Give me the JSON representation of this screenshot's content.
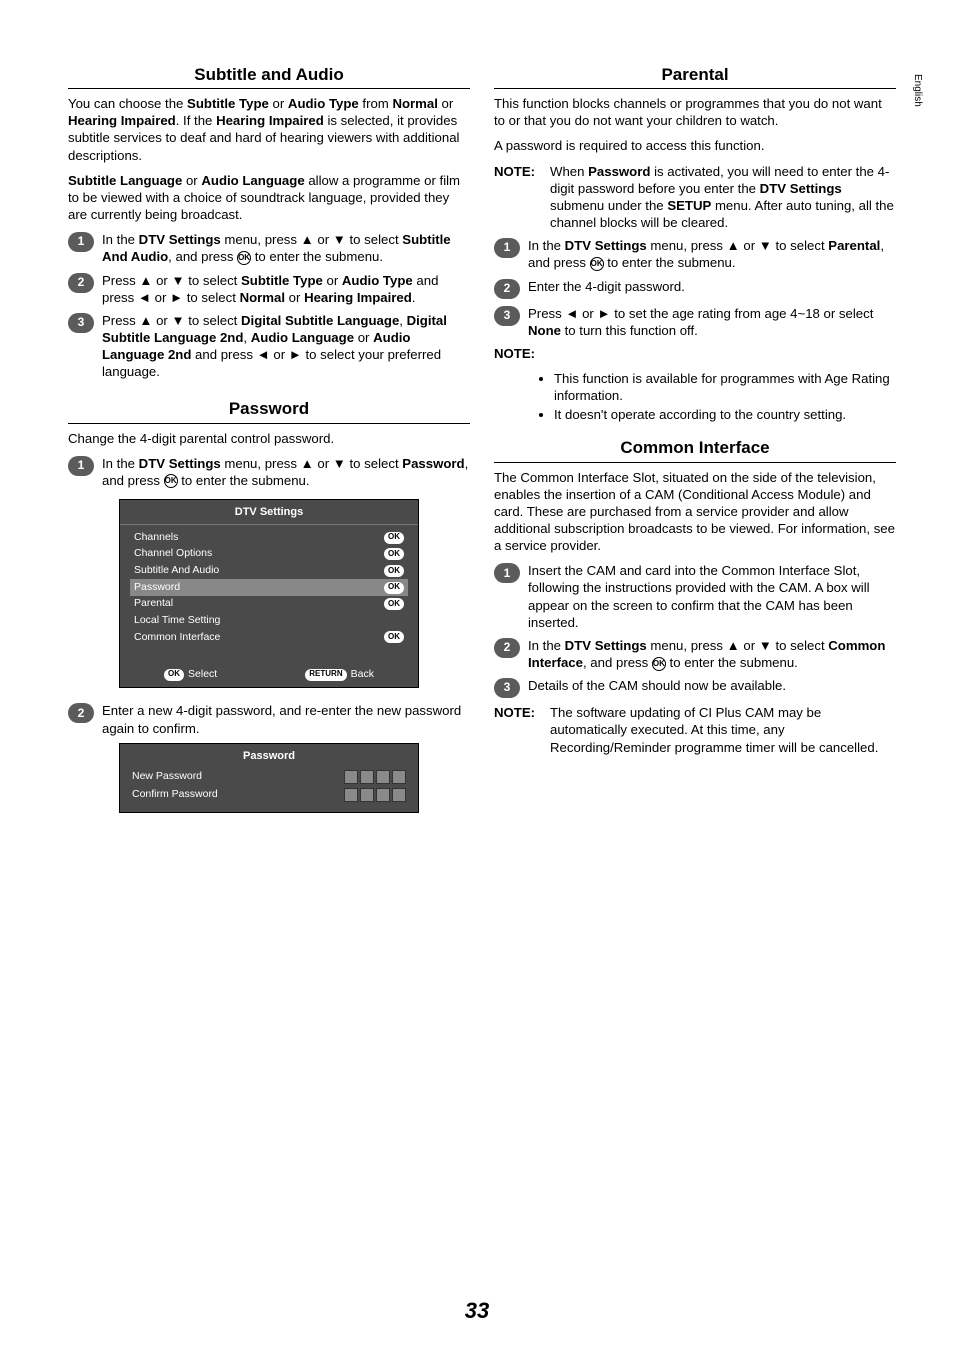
{
  "sideTab": "English",
  "pageNumber": "33",
  "glyph": {
    "up": "▲",
    "down": "▼",
    "left": "◄",
    "right": "►"
  },
  "btn": {
    "ok": "OK",
    "okCircle": "OK",
    "return": "RETURN"
  },
  "left": {
    "sec1": {
      "title": "Subtitle and Audio",
      "p1a": "You can choose the ",
      "p1b": "Subtitle Type",
      "p1c": " or ",
      "p1d": "Audio Type",
      "p1e": " from ",
      "p1f": "Normal",
      "p1g": " or ",
      "p1h": "Hearing Impaired",
      "p1i": ". If the ",
      "p1j": "Hearing Impaired",
      "p1k": " is selected, it provides subtitle services to deaf and hard of hearing viewers with additional descriptions.",
      "p2a": "Subtitle Language",
      "p2b": " or ",
      "p2c": "Audio Language",
      "p2d": " allow a programme or film to be viewed with a choice of soundtrack language, provided they are currently being broadcast.",
      "s1a": "In the ",
      "s1b": "DTV Settings",
      "s1c": " menu, press ",
      "s1d": " or ",
      "s1e": " to select ",
      "s1f": "Subtitle And Audio",
      "s1g": ", and press ",
      "s1h": " to enter the submenu.",
      "s2a": "Press ",
      "s2b": " or ",
      "s2c": " to select ",
      "s2d": "Subtitle Type",
      "s2e": " or ",
      "s2f": "Audio Type",
      "s2g": " and press ",
      "s2h": " or ",
      "s2i": " to select ",
      "s2j": "Normal",
      "s2k": " or ",
      "s2l": "Hearing Impaired",
      "s2m": ".",
      "s3a": "Press ",
      "s3b": " or ",
      "s3c": " to select ",
      "s3d": "Digital Subtitle Language",
      "s3e": ", ",
      "s3f": "Digital Subtitle Language 2nd",
      "s3g": ", ",
      "s3h": "Audio Language",
      "s3i": " or ",
      "s3j": "Audio Language 2nd",
      "s3k": " and press ",
      "s3l": " or ",
      "s3m": " to select your preferred language."
    },
    "sec2": {
      "title": "Password",
      "p1": "Change the 4-digit parental control password.",
      "s1a": "In the ",
      "s1b": "DTV Settings",
      "s1c": " menu, press ",
      "s1d": " or ",
      "s1e": " to select ",
      "s1f": "Password",
      "s1g": ", and press ",
      "s1h": " to enter the submenu.",
      "s2": "Enter a new 4-digit password, and re-enter the new password again to confirm."
    },
    "osd": {
      "title": "DTV Settings",
      "rows": [
        "Channels",
        "Channel Options",
        "Subtitle And Audio",
        "Password",
        "Parental",
        "Local Time Setting",
        "Common Interface"
      ],
      "okRows": [
        0,
        1,
        2,
        3,
        4,
        6
      ],
      "selIndex": 3,
      "footSelect": "Select",
      "footBack": "Back"
    },
    "pwd": {
      "title": "Password",
      "row1": "New Password",
      "row2": "Confirm Password"
    }
  },
  "right": {
    "sec1": {
      "title": "Parental",
      "p1": "This function blocks channels or programmes that you do not want to or that you do not want your children to watch.",
      "p2": "A password is required to access this function.",
      "noteLabel": "NOTE:",
      "noteA": " When ",
      "noteB": "Password",
      "noteC": " is activated, you will need to enter the 4-digit password before you enter the ",
      "noteD": "DTV Settings",
      "noteE": " submenu under the ",
      "noteF": "SETUP",
      "noteG": " menu. After auto tuning, all the channel blocks will be cleared.",
      "s1a": "In the ",
      "s1b": "DTV Settings",
      "s1c": " menu, press ",
      "s1d": " or ",
      "s1e": " to select ",
      "s1f": "Parental",
      "s1g": ", and press ",
      "s1h": " to enter the submenu.",
      "s2": "Enter the 4-digit password.",
      "s3a": "Press ",
      "s3b": " or ",
      "s3c": " to set the age rating from age 4~18 or select ",
      "s3d": "None",
      "s3e": " to turn this function off.",
      "nlabel": "NOTE:",
      "n1": "This function is available for programmes with Age Rating information.",
      "n2": "It doesn't operate according to the country setting."
    },
    "sec2": {
      "title": "Common Interface",
      "p1": "The Common Interface Slot, situated on the side of the television, enables the insertion of a CAM (Conditional Access Module) and card. These are purchased from a service provider and allow additional subscription broadcasts to be viewed. For information, see a service provider.",
      "s1": "Insert the CAM and card into the Common Interface Slot, following the instructions provided with the CAM. A box will appear on the screen to confirm that the CAM has been inserted.",
      "s2a": "In the ",
      "s2b": "DTV Settings",
      "s2c": " menu, press ",
      "s2d": " or ",
      "s2e": " to select ",
      "s2f": "Common Interface",
      "s2g": ", and press ",
      "s2h": " to enter the submenu.",
      "s3": "Details of the CAM should now be available.",
      "noteLabel": "NOTE:",
      "noteText": " The software updating of CI Plus CAM may be automatically executed. At this time, any Recording/Reminder programme timer will be cancelled."
    }
  }
}
